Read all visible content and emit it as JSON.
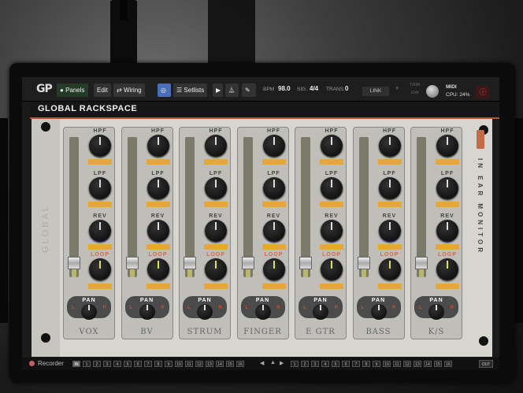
{
  "toolbar": {
    "logo": "GP",
    "panels_label": "Panels",
    "edit_label": "Edit",
    "wiring_label": "Wiring",
    "setlists_label": "Setlists",
    "bpm_label": "BPM",
    "bpm_value": "98.0",
    "sig_label": "SIG.",
    "sig_value": "4/4",
    "trans_label": "TRANS.",
    "trans_value": "0",
    "link_label": "LINK",
    "trim_label": "TRIM",
    "edit_small_label": "Edit",
    "midi_label": "MIDI",
    "cpu_label": "CPU:",
    "cpu_value": "24%"
  },
  "rackspace": {
    "title": "GLOBAL RACKSPACE",
    "side_label": "GLOBAL",
    "iem_label": "IN EAR MONITOR",
    "knob_labels": {
      "hpf": "HPF",
      "lpf": "LPF",
      "rev": "REV",
      "loop": "LOOP",
      "pan": "PAN",
      "pan_l": "L",
      "pan_r": "R"
    },
    "strips": [
      {
        "name": "VOX",
        "fader_level": 0.1
      },
      {
        "name": "BV",
        "fader_level": 0.1
      },
      {
        "name": "STRUM",
        "fader_level": 0.1
      },
      {
        "name": "FINGER",
        "fader_level": 0.1
      },
      {
        "name": "E GTR",
        "fader_level": 0.1
      },
      {
        "name": "BASS",
        "fader_level": 0.1
      },
      {
        "name": "K/S",
        "fader_level": 0.1
      }
    ]
  },
  "bottombar": {
    "recorder_label": "Recorder",
    "in_label": "IN",
    "out_label": "OUT",
    "input_numbers": [
      "1",
      "2",
      "3",
      "4",
      "5",
      "6",
      "7",
      "8",
      "9",
      "10",
      "11",
      "12",
      "13",
      "14",
      "15",
      "16"
    ],
    "output_numbers": [
      "1",
      "2",
      "3",
      "4",
      "5",
      "6",
      "7",
      "8",
      "9",
      "10",
      "11",
      "12",
      "13",
      "14",
      "15",
      "16"
    ],
    "nav_prev": "◀",
    "nav_up": "▲",
    "nav_next": "▶"
  },
  "colors": {
    "accent_orange": "#e6a63a",
    "title_underline": "#b0573a",
    "pan_marker": "#c0502a"
  }
}
